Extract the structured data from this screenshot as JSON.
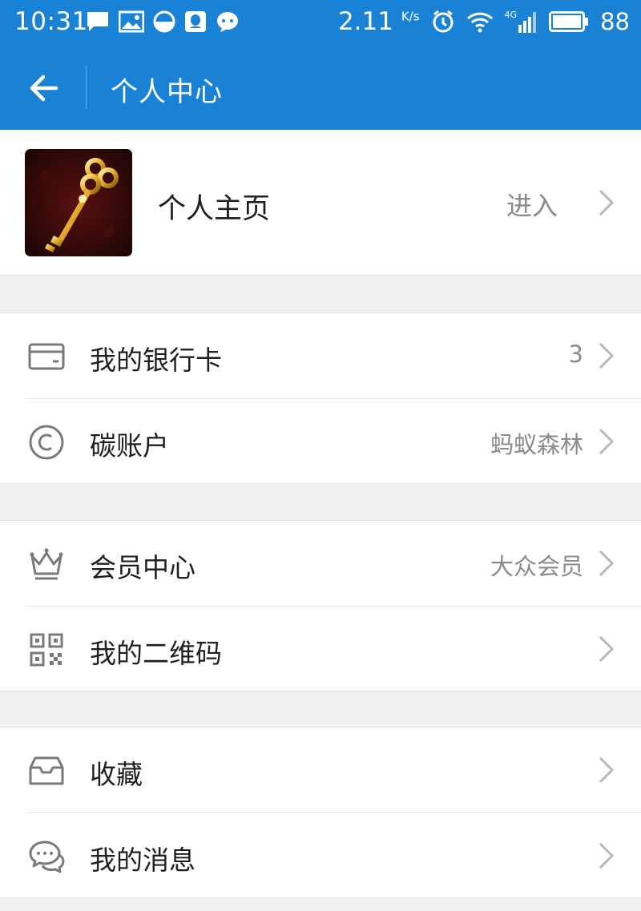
{
  "status_bar": {
    "time": "10:31",
    "speed": "2.11",
    "speed_unit": "K/s",
    "network": "4G",
    "battery": "88"
  },
  "app_bar": {
    "title": "个人中心"
  },
  "profile": {
    "label": "个人主页",
    "action": "进入"
  },
  "groups": [
    {
      "rows": [
        {
          "label": "我的银行卡",
          "value": "3",
          "icon": "bank-card-icon"
        },
        {
          "label": "碳账户",
          "value": "蚂蚁森林",
          "icon": "copyright-c-icon"
        }
      ]
    },
    {
      "rows": [
        {
          "label": "会员中心",
          "value": "大众会员",
          "icon": "crown-icon"
        },
        {
          "label": "我的二维码",
          "value": "",
          "icon": "qr-code-icon"
        }
      ]
    },
    {
      "rows": [
        {
          "label": "收藏",
          "value": "",
          "icon": "inbox-tray-icon"
        },
        {
          "label": "我的消息",
          "value": "",
          "icon": "chat-bubbles-icon"
        }
      ]
    }
  ],
  "colors": {
    "primary": "#1a82d4",
    "background": "#f0f0f3",
    "text": "#1f1f1f",
    "secondary_text": "#8a8a8a"
  }
}
